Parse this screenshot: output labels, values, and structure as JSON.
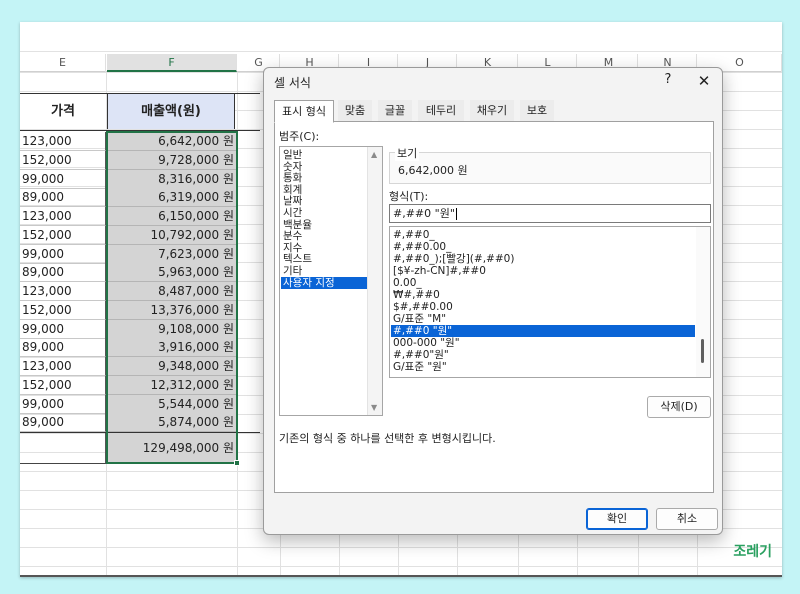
{
  "sheet": {
    "columns": [
      "E",
      "F",
      "G",
      "H",
      "I",
      "J",
      "K",
      "L",
      "M",
      "N",
      "O"
    ],
    "header_e": "가격",
    "header_f": "매출액(원)",
    "rows": [
      {
        "e": "123,000",
        "f": "6,642,000 원"
      },
      {
        "e": "152,000",
        "f": "9,728,000 원"
      },
      {
        "e": "99,000",
        "f": "8,316,000 원"
      },
      {
        "e": "89,000",
        "f": "6,319,000 원"
      },
      {
        "e": "123,000",
        "f": "6,150,000 원"
      },
      {
        "e": "152,000",
        "f": "10,792,000 원"
      },
      {
        "e": "99,000",
        "f": "7,623,000 원"
      },
      {
        "e": "89,000",
        "f": "5,963,000 원"
      },
      {
        "e": "123,000",
        "f": "8,487,000 원"
      },
      {
        "e": "152,000",
        "f": "13,376,000 원"
      },
      {
        "e": "99,000",
        "f": "9,108,000 원"
      },
      {
        "e": "89,000",
        "f": "3,916,000 원"
      },
      {
        "e": "123,000",
        "f": "9,348,000 원"
      },
      {
        "e": "152,000",
        "f": "12,312,000 원"
      },
      {
        "e": "99,000",
        "f": "5,544,000 원"
      },
      {
        "e": "89,000",
        "f": "5,874,000 원"
      }
    ],
    "total": "129,498,000 원",
    "brand": "조레기",
    "accent_color": "#217346"
  },
  "dialog": {
    "title": "셀 서식",
    "help": "?",
    "close": "✕",
    "tabs": [
      "표시 형식",
      "맞춤",
      "글꼴",
      "테두리",
      "채우기",
      "보호"
    ],
    "category_label": "범주(C):",
    "categories": [
      "일반",
      "숫자",
      "통화",
      "회계",
      "날짜",
      "시간",
      "백분율",
      "분수",
      "지수",
      "텍스트",
      "기타",
      "사용자 지정"
    ],
    "selected_category": 11,
    "sample_label": "보기",
    "sample_value": "6,642,000 원",
    "format_label": "형식(T):",
    "format_value": "#,##0 \"원\"",
    "formats": [
      "#,##0_",
      "#,##0.00_",
      "#,##0_);[빨강](#,##0)",
      "[$¥-zh-CN]#,##0",
      "0.00_",
      "₩#,##0",
      "$#,##0.00",
      "G/표준   \"M\"",
      "#,##0 \"원\"",
      "000-000 \"원\"",
      "#,##0\"원\"",
      "G/표준 \"원\""
    ],
    "selected_format": 8,
    "delete_button": "삭제(D)",
    "description": "기존의 형식 중 하나를 선택한 후 변형시킵니다.",
    "ok_button": "확인",
    "cancel_button": "취소",
    "selection_color": "#0a64d6"
  }
}
